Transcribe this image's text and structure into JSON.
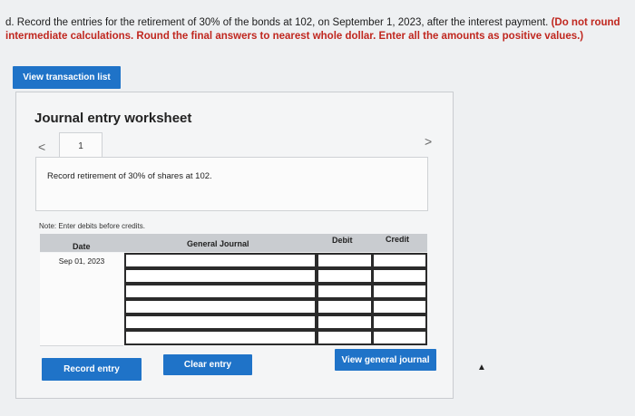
{
  "question": {
    "text": "d. Record the entries for the retirement of 30% of the bonds at 102, on September 1, 2023, after the interest payment.",
    "warning": "(Do not round intermediate calculations. Round the final answers to nearest whole dollar. Enter all the amounts as positive values.)"
  },
  "buttons": {
    "view_transactions": "View transaction list",
    "record_entry": "Record entry",
    "clear_entry": "Clear entry",
    "view_general_journal": "View general journal"
  },
  "worksheet": {
    "title": "Journal entry worksheet",
    "tab_number": "1",
    "prev_glyph": "<",
    "next_glyph": ">",
    "description": "Record retirement of 30% of shares at 102.",
    "note": "Note: Enter debits before credits."
  },
  "journal": {
    "columns": {
      "date": "Date",
      "general_journal": "General Journal",
      "debit": "Debit",
      "credit": "Credit"
    },
    "rows": [
      {
        "date": "Sep 01, 2023",
        "account": "",
        "debit": "",
        "credit": ""
      },
      {
        "date": "",
        "account": "",
        "debit": "",
        "credit": ""
      },
      {
        "date": "",
        "account": "",
        "debit": "",
        "credit": ""
      },
      {
        "date": "",
        "account": "",
        "debit": "",
        "credit": ""
      },
      {
        "date": "",
        "account": "",
        "debit": "",
        "credit": ""
      },
      {
        "date": "",
        "account": "",
        "debit": "",
        "credit": ""
      }
    ]
  },
  "colors": {
    "accent": "#1f73c8",
    "warning": "#c0271f",
    "header_gray": "#c9ccd0"
  }
}
